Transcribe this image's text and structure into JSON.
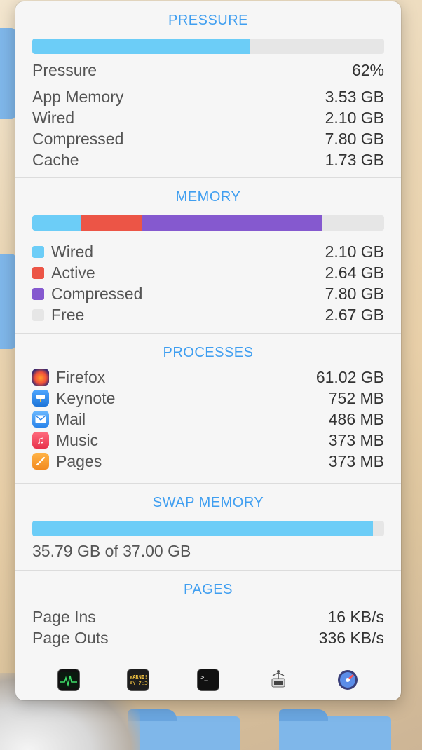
{
  "pressure": {
    "title": "PRESSURE",
    "bar_fraction": 0.62,
    "bar_color": "#6ccdf7",
    "rows": [
      {
        "label": "Pressure",
        "value": "62%"
      },
      {
        "label": "App Memory",
        "value": "3.53 GB"
      },
      {
        "label": "Wired",
        "value": "2.10 GB"
      },
      {
        "label": "Compressed",
        "value": "7.80 GB"
      },
      {
        "label": "Cache",
        "value": "1.73 GB"
      }
    ]
  },
  "memory": {
    "title": "MEMORY",
    "items": [
      {
        "label": "Wired",
        "value": "2.10 GB",
        "gb": 2.1,
        "color": "#6ccdf7"
      },
      {
        "label": "Active",
        "value": "2.64 GB",
        "gb": 2.64,
        "color": "#ec5546"
      },
      {
        "label": "Compressed",
        "value": "7.80 GB",
        "gb": 7.8,
        "color": "#8559cf"
      },
      {
        "label": "Free",
        "value": "2.67 GB",
        "gb": 2.67,
        "color": "#e6e6e6"
      }
    ]
  },
  "processes": {
    "title": "PROCESSES",
    "items": [
      {
        "name": "Firefox",
        "value": "61.02 GB",
        "icon": "firefox-icon",
        "color": "#3b2a6e"
      },
      {
        "name": "Keynote",
        "value": "752 MB",
        "icon": "keynote-icon",
        "color": "#2f8be6"
      },
      {
        "name": "Mail",
        "value": "486 MB",
        "icon": "mail-icon",
        "color": "#3d93f0"
      },
      {
        "name": "Music",
        "value": "373 MB",
        "icon": "music-icon",
        "color": "#f0465a"
      },
      {
        "name": "Pages",
        "value": "373 MB",
        "icon": "pages-icon",
        "color": "#f49a2a"
      }
    ]
  },
  "swap": {
    "title": "SWAP MEMORY",
    "used_gb": 35.79,
    "total_gb": 37.0,
    "text": "35.79 GB of 37.00 GB",
    "color": "#6ccdf7"
  },
  "pages": {
    "title": "PAGES",
    "rows": [
      {
        "label": "Page Ins",
        "value": "16 KB/s"
      },
      {
        "label": "Page Outs",
        "value": "336 KB/s"
      }
    ]
  },
  "toolbar": [
    {
      "name": "activity-monitor-icon"
    },
    {
      "name": "console-icon",
      "text": "WARNI!\nAY 7:36"
    },
    {
      "name": "terminal-icon",
      "text": ">_"
    },
    {
      "name": "system-information-icon"
    },
    {
      "name": "disk-diag-icon"
    }
  ],
  "accent_color": "#3f9ef0"
}
